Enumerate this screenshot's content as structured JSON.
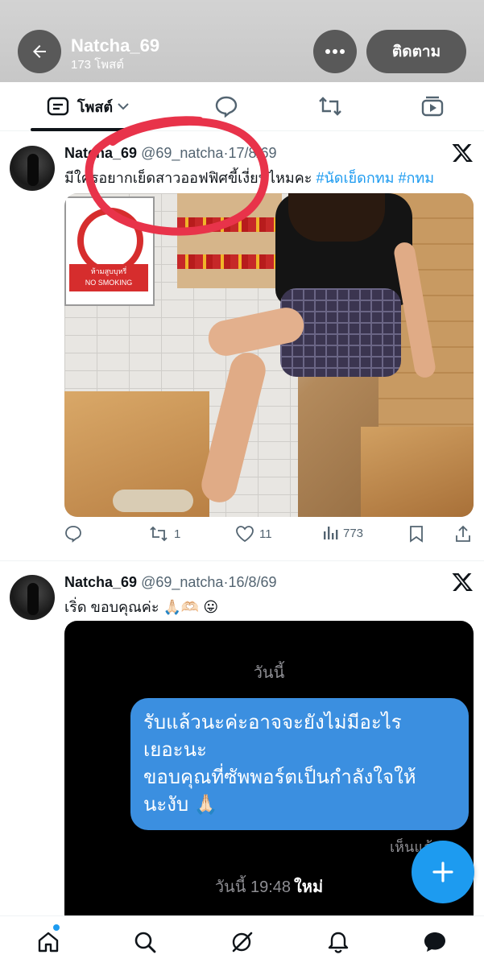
{
  "header": {
    "name": "Natcha_69",
    "post_count": "173 โพสต์",
    "follow_label": "ติดตาม"
  },
  "tabs": {
    "posts_label": "โพสต์"
  },
  "tweets": [
    {
      "name": "Natcha_69",
      "handle": "@69_natcha",
      "date": "17/8/69",
      "text": "มีใครอยากเย็ดสาวออฟฟิศขี้เงี่ยนไหมคะ ",
      "hashtags": [
        "#นัดเย็ดกทม",
        "#กทม"
      ],
      "replies": "",
      "reposts": "1",
      "likes": "11",
      "views": "773",
      "media_sign_line1": "ห้ามสูบบุหรี่",
      "media_sign_line2": "NO SMOKING"
    },
    {
      "name": "Natcha_69",
      "handle": "@69_natcha",
      "date": "16/8/69",
      "text": "เริ่ด ขอบคุณค่ะ 🙏🏻🫶🏻 😛",
      "chat": {
        "today": "วันนี้",
        "bubble_line1": "รับแล้วนะค่ะอาจจะยังไม่มีอะไร",
        "bubble_line2": "เยอะนะ",
        "bubble_line3": "ขอบคุณที่ซัพพอร์ตเป็นกำลังใจให้",
        "bubble_line4": "นะงับ 🙏🏻",
        "seen": "เห็นแล้ว",
        "time": "วันนี้ 19:48",
        "new_label": "ใหม่"
      }
    }
  ],
  "icons": {
    "back": "arrow-left-icon",
    "more": "more-horizontal-icon",
    "x_logo": "x-logo-icon",
    "compose": "plus-icon"
  },
  "colors": {
    "accent": "#1d9bf0",
    "scribble": "#e8334a",
    "chat_bubble": "#3b8fe0"
  }
}
